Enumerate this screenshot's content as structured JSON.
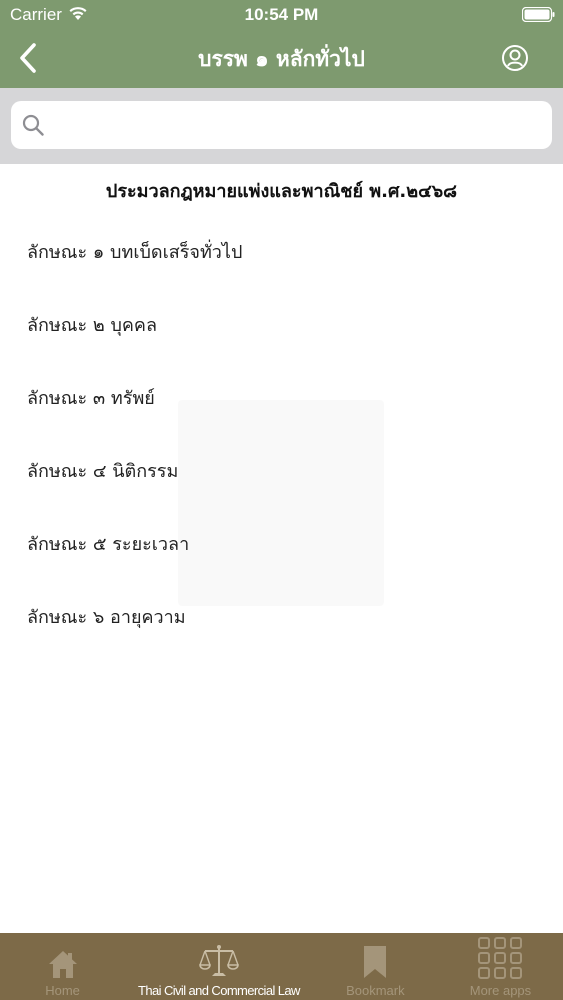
{
  "status_bar": {
    "carrier": "Carrier",
    "time": "10:54 PM"
  },
  "nav": {
    "title": "บรรพ ๑ หลักทั่วไป"
  },
  "search": {
    "placeholder": "",
    "value": ""
  },
  "content": {
    "book_title": "ประมวลกฎหมายแพ่งและพาณิชย์ พ.ศ.๒๔๖๘",
    "chapters": [
      {
        "label": "ลักษณะ ๑ บทเบ็ดเสร็จทั่วไป"
      },
      {
        "label": "ลักษณะ ๒ บุคคล"
      },
      {
        "label": "ลักษณะ ๓ ทรัพย์"
      },
      {
        "label": "ลักษณะ ๔ นิติกรรม"
      },
      {
        "label": "ลักษณะ ๕ ระยะเวลา"
      },
      {
        "label": "ลักษณะ ๖ อายุความ"
      }
    ]
  },
  "tab_bar": {
    "tabs": [
      {
        "label": "Home",
        "icon": "home-icon"
      },
      {
        "label": "Thai Civil and Commercial Law",
        "icon": "scales-icon",
        "active": true
      },
      {
        "label": "Bookmark",
        "icon": "bookmark-icon"
      },
      {
        "label": "More apps",
        "icon": "grid-icon"
      }
    ]
  },
  "colors": {
    "header": "#7e9a6f",
    "tab_bar": "#7d6a48",
    "search_area": "#d6d6d8",
    "tab_inactive": "#a4957a",
    "tab_active": "#ffffff"
  }
}
